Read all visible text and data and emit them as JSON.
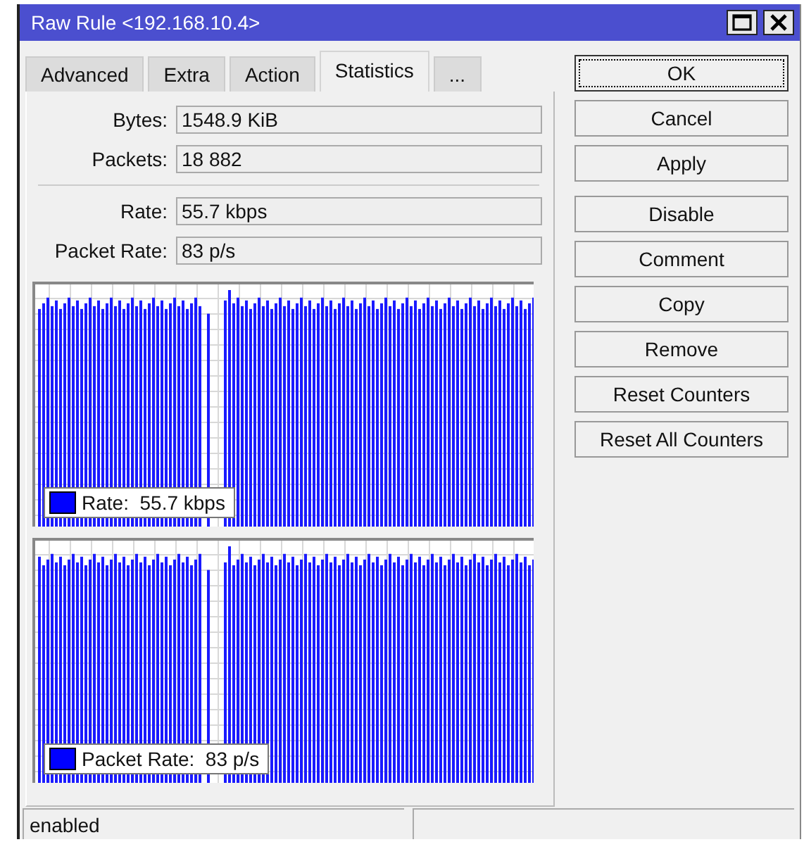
{
  "window": {
    "title": "Raw Rule <192.168.10.4>"
  },
  "tabs": [
    {
      "label": "Advanced",
      "selected": false
    },
    {
      "label": "Extra",
      "selected": false
    },
    {
      "label": "Action",
      "selected": false
    },
    {
      "label": "Statistics",
      "selected": true
    },
    {
      "label": "...",
      "selected": false
    }
  ],
  "field_groups": [
    [
      {
        "label": "Bytes:",
        "value": "1548.9 KiB"
      },
      {
        "label": "Packets:",
        "value": "18 882"
      }
    ],
    [
      {
        "label": "Rate:",
        "value": "55.7 kbps"
      },
      {
        "label": "Packet Rate:",
        "value": "83 p/s"
      }
    ]
  ],
  "graphs": [
    {
      "legend_label": "Rate:",
      "legend_value": "55.7 kbps"
    },
    {
      "legend_label": "Packet Rate:",
      "legend_value": "83 p/s"
    }
  ],
  "button_groups": [
    [
      {
        "label": "OK",
        "focused": true
      },
      {
        "label": "Cancel",
        "focused": false
      },
      {
        "label": "Apply",
        "focused": false
      }
    ],
    [
      {
        "label": "Disable",
        "focused": false
      },
      {
        "label": "Comment",
        "focused": false
      },
      {
        "label": "Copy",
        "focused": false
      },
      {
        "label": "Remove",
        "focused": false
      },
      {
        "label": "Reset Counters",
        "focused": false
      },
      {
        "label": "Reset All Counters",
        "focused": false
      }
    ]
  ],
  "status_bar": {
    "status": "enabled"
  }
}
